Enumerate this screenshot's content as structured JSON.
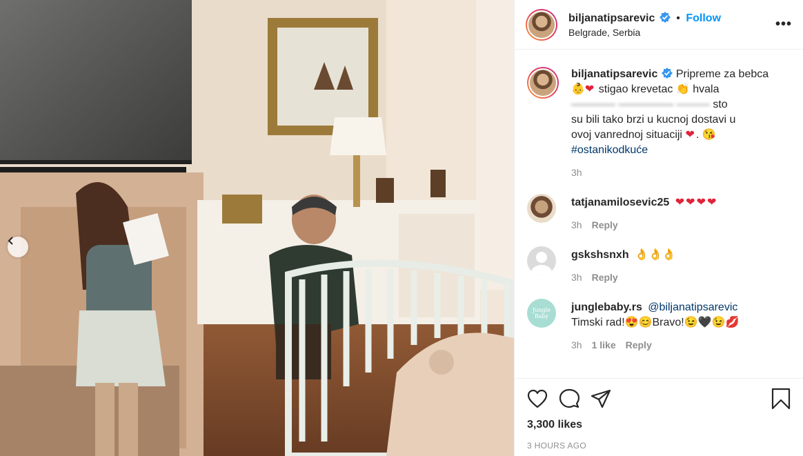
{
  "header": {
    "username": "biljanatipsarevic",
    "follow_label": "Follow",
    "location": "Belgrade, Serbia"
  },
  "caption": {
    "username": "biljanatipsarevic",
    "text_line1": "Pripreme za bebca",
    "text_line2": "stigao krevetac",
    "text_line2b": "hvala",
    "text_blurred": "sto",
    "text_line4": "su bili tako brzi u kucnoj dostavi u",
    "text_line5": "ovoj vanrednoj situaciji",
    "hashtag": "#ostanikodkuće",
    "time": "3h"
  },
  "comments": [
    {
      "username": "tatjanamilosevic25",
      "text": "❤❤❤❤",
      "time": "3h",
      "reply": "Reply"
    },
    {
      "username": "gskshsnxh",
      "text": "👌👌👌",
      "time": "3h",
      "reply": "Reply"
    },
    {
      "username": "junglebaby.rs",
      "mention": "@biljanatipsarevic",
      "text": "Timski rad!😍😊Bravo!😉🖤😉💋",
      "time": "3h",
      "extra": "1 like",
      "reply": "Reply",
      "avatar_text": "Jungle Baby"
    }
  ],
  "actions": {
    "likes": "3,300 likes",
    "timestamp": "3 HOURS AGO"
  },
  "colors": {
    "accent": "#0095f6",
    "text": "#262626",
    "muted": "#8e8e8e",
    "heart": "#e0243a"
  },
  "icons": [
    "heart-icon",
    "comment-icon",
    "share-icon",
    "bookmark-icon",
    "more-icon",
    "verified-icon",
    "chevron-left-icon"
  ]
}
